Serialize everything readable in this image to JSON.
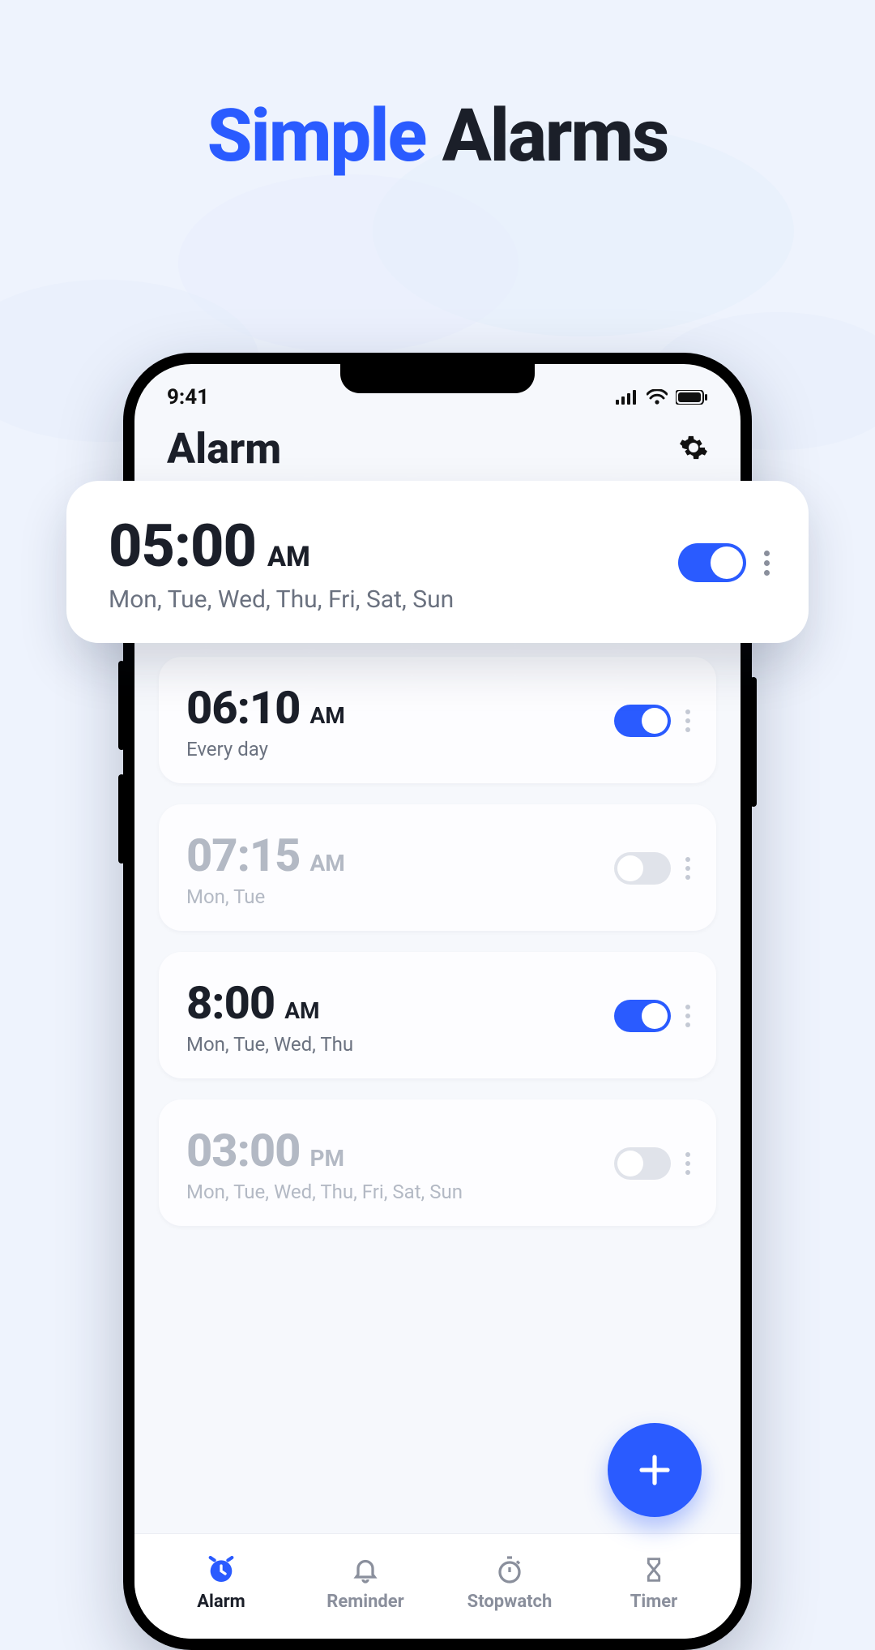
{
  "headline": {
    "accent": "Simple",
    "rest": "Alarms"
  },
  "status": {
    "time": "9:41"
  },
  "header": {
    "title": "Alarm"
  },
  "highlight_alarm": {
    "time": "05:00",
    "ampm": "AM",
    "days": "Mon, Tue, Wed, Thu, Fri, Sat, Sun",
    "enabled": true
  },
  "alarms": [
    {
      "time": "06:10",
      "ampm": "AM",
      "days": "Every day",
      "enabled": true
    },
    {
      "time": "07:15",
      "ampm": "AM",
      "days": "Mon, Tue",
      "enabled": false
    },
    {
      "time": "8:00",
      "ampm": "AM",
      "days": "Mon, Tue, Wed, Thu",
      "enabled": true
    },
    {
      "time": "03:00",
      "ampm": "PM",
      "days": "Mon, Tue, Wed, Thu, Fri, Sat, Sun",
      "enabled": false
    }
  ],
  "nav": [
    {
      "label": "Alarm",
      "active": true
    },
    {
      "label": "Reminder",
      "active": false
    },
    {
      "label": "Stopwatch",
      "active": false
    },
    {
      "label": "Timer",
      "active": false
    }
  ],
  "colors": {
    "accent": "#2a5bff"
  }
}
